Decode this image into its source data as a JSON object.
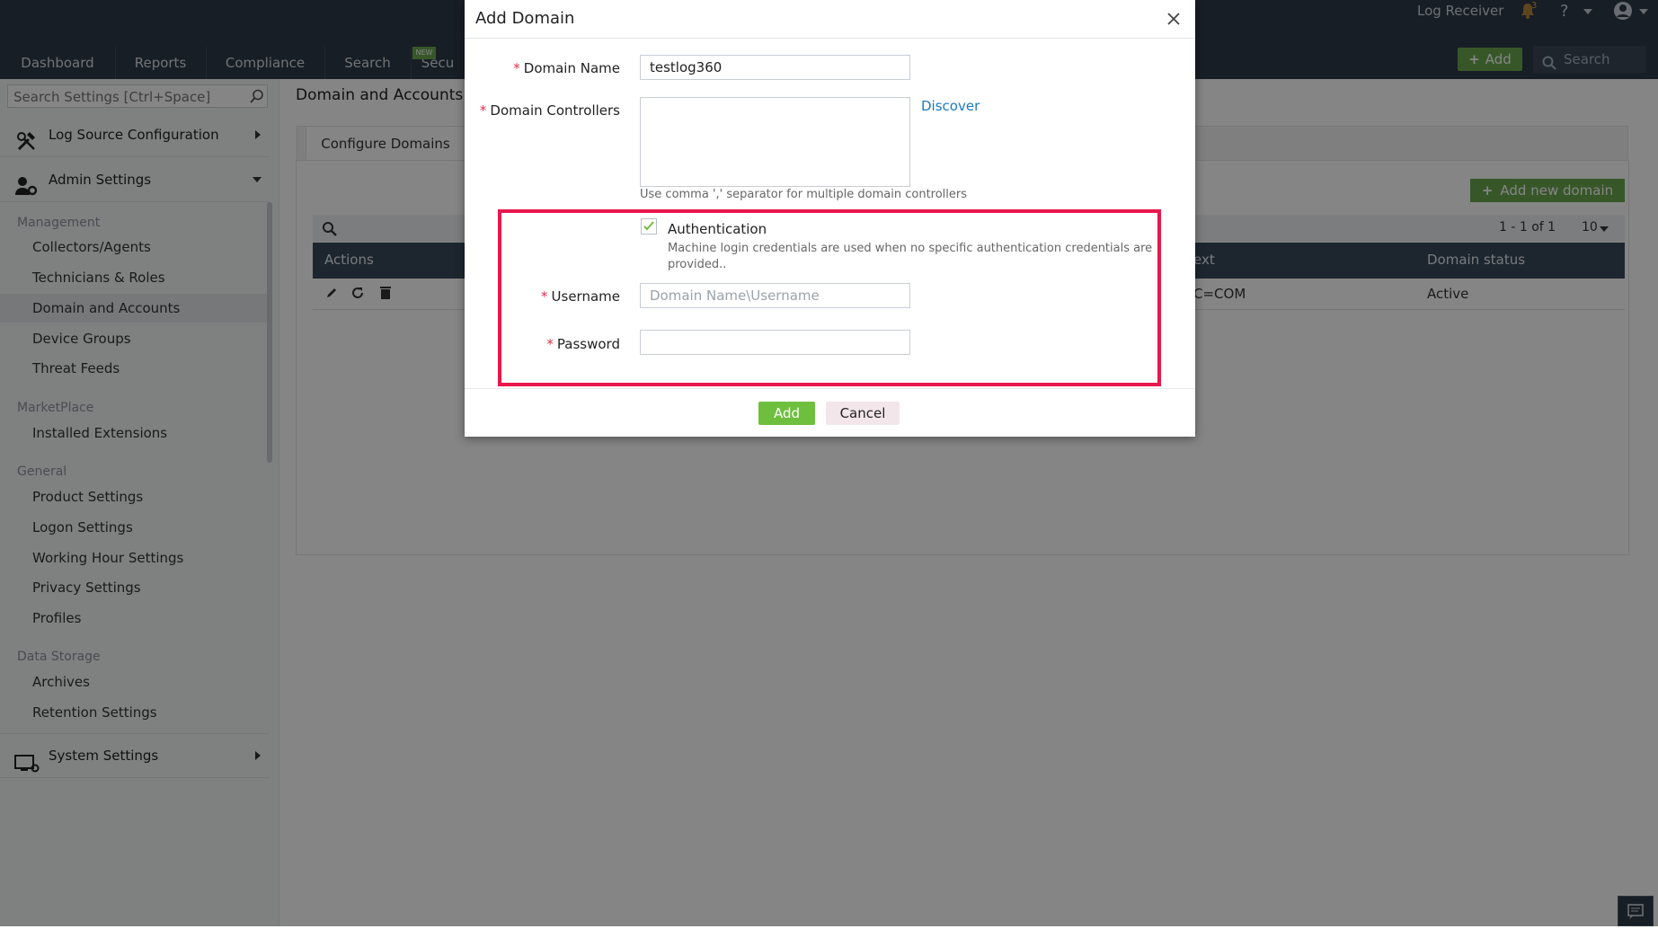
{
  "header": {
    "tabs": [
      "Dashboard",
      "Reports",
      "Compliance",
      "Search",
      "Secu"
    ],
    "new_badge": "NEW",
    "log_receiver": "Log Receiver",
    "notification_count": "3",
    "help": "?",
    "add_label": "Add",
    "search_placeholder": "Search"
  },
  "sidebar": {
    "search_placeholder": "Search Settings [Ctrl+Space]",
    "log_source": "Log Source Configuration",
    "admin_settings": "Admin Settings",
    "groups": {
      "management": "Management",
      "marketplace": "MarketPlace",
      "general": "General",
      "data_storage": "Data Storage"
    },
    "items": {
      "collectors": "Collectors/Agents",
      "technicians": "Technicians & Roles",
      "domain_accounts": "Domain and Accounts",
      "device_groups": "Device Groups",
      "threat_feeds": "Threat Feeds",
      "installed_ext": "Installed Extensions",
      "product_settings": "Product Settings",
      "logon_settings": "Logon Settings",
      "working_hour": "Working Hour Settings",
      "privacy": "Privacy Settings",
      "profiles": "Profiles",
      "archives": "Archives",
      "retention": "Retention Settings"
    },
    "system_settings": "System Settings"
  },
  "main": {
    "title": "Domain and Accounts",
    "tab": "Configure Domains",
    "add_new_domain": "Add new domain",
    "pagination": "1 - 1 of 1",
    "page_size": "10",
    "columns": {
      "actions": "Actions",
      "context": "ext",
      "status": "Domain status"
    },
    "row": {
      "context": "C=COM",
      "status": "Active"
    }
  },
  "modal": {
    "title": "Add Domain",
    "domain_name_label": "Domain Name",
    "domain_name_value": "testlog360",
    "dc_label": "Domain Controllers",
    "discover": "Discover",
    "dc_hint": "Use comma ',' separator for multiple domain controllers",
    "auth_label": "Authentication",
    "auth_hint": "Machine login credentials are used when no specific authentication credentials are provided..",
    "auth_checked": true,
    "username_label": "Username",
    "username_placeholder": "Domain Name\\Username",
    "password_label": "Password",
    "add_button": "Add",
    "cancel_button": "Cancel",
    "highlight_color": "#e8174c"
  }
}
